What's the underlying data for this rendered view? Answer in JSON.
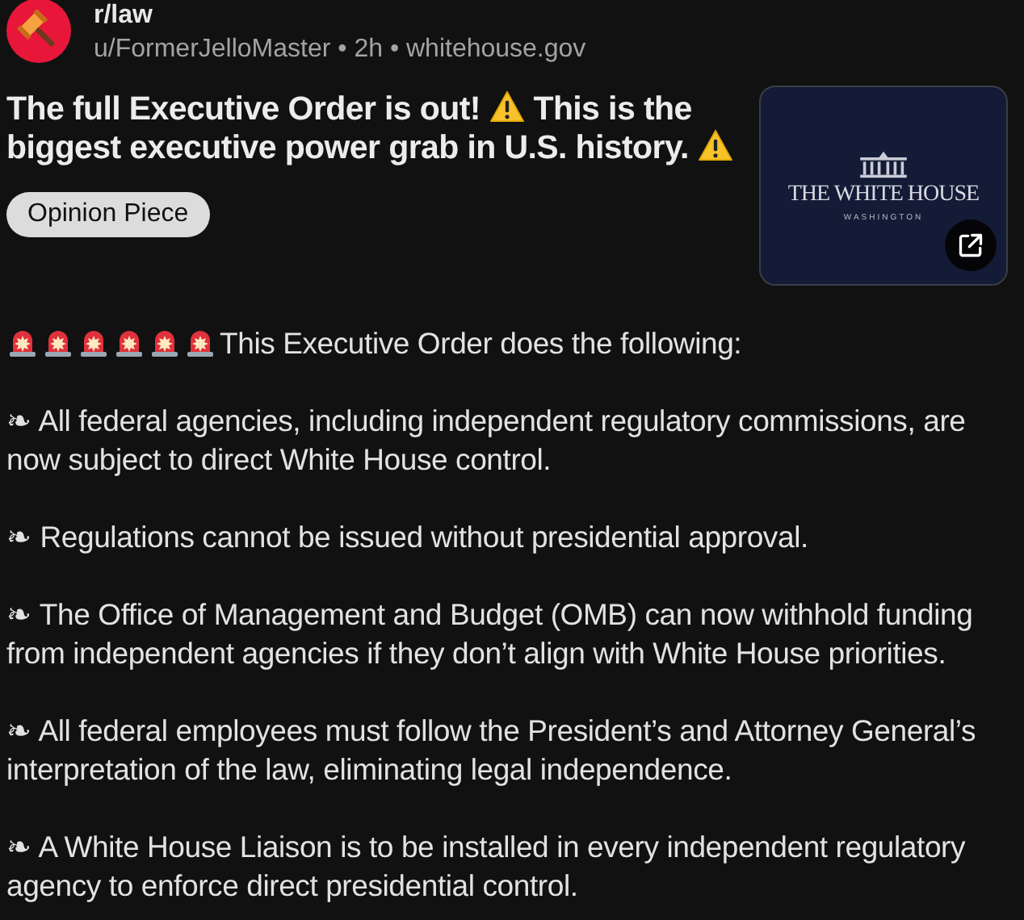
{
  "post": {
    "subreddit": "r/law",
    "meta": "u/FormerJelloMaster • 2h • whitehouse.gov",
    "title_parts": [
      {
        "kind": "text",
        "text": "The full Executive Order is out!"
      },
      {
        "kind": "warning"
      },
      {
        "kind": "text",
        "text": "This is the"
      },
      {
        "kind": "text",
        "text": "biggest executive power grab in U.S. history."
      },
      {
        "kind": "warning"
      }
    ],
    "flair": "Opinion Piece",
    "thumbnail": {
      "title": "THE WHITE HOUSE",
      "subtitle": "WASHINGTON"
    }
  },
  "body": [
    {
      "parts": [
        {
          "kind": "siren"
        },
        {
          "kind": "siren"
        },
        {
          "kind": "siren"
        },
        {
          "kind": "siren"
        },
        {
          "kind": "siren"
        },
        {
          "kind": "siren"
        },
        {
          "kind": "text",
          "text": "This Executive Order does the following:"
        }
      ]
    },
    {
      "parts": [
        {
          "kind": "text",
          "text": "❧ All federal agencies, including independent regulatory commissions, are now subject to direct White House control."
        }
      ]
    },
    {
      "parts": [
        {
          "kind": "text",
          "text": "❧ Regulations cannot be issued without presidential approval."
        }
      ]
    },
    {
      "parts": [
        {
          "kind": "text",
          "text": "❧ The Office of Management and Budget (OMB) can now withhold funding from independent agencies if they don’t align with White House priorities."
        }
      ]
    },
    {
      "parts": [
        {
          "kind": "text",
          "text": "❧ All federal employees must follow the President’s and Attorney General’s interpretation of the law, eliminating legal independence."
        }
      ]
    },
    {
      "parts": [
        {
          "kind": "text",
          "text": "❧ A White House Liaison is to be installed in every independent regulatory agency to enforce direct presidential control."
        }
      ]
    }
  ]
}
